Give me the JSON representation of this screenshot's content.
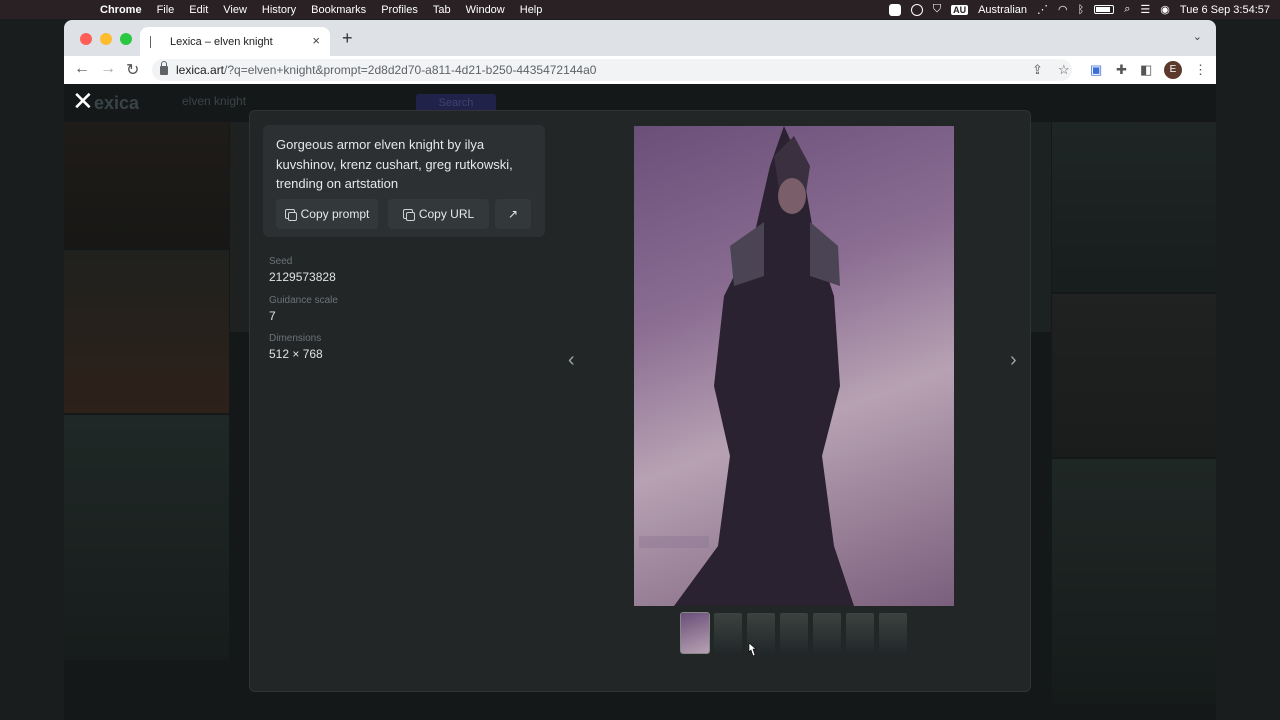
{
  "menubar": {
    "apple": "",
    "app": "Chrome",
    "items": [
      "File",
      "Edit",
      "View",
      "History",
      "Bookmarks",
      "Profiles",
      "Tab",
      "Window",
      "Help"
    ],
    "input_source": "Australian",
    "au": "AU",
    "clock": "Tue 6 Sep  3:54:57"
  },
  "browser": {
    "tab_title": "Lexica – elven knight",
    "url_host": "lexica.art",
    "url_path": "/?q=elven+knight&prompt=2d8d2d70-a811-4d21-b250-4435472144a0",
    "profile_initial": "E"
  },
  "page": {
    "logo_text": "exica",
    "search_query": "elven knight",
    "search_button": "Search",
    "close_label": "✕"
  },
  "modal": {
    "prompt": "Gorgeous armor elven knight by ilya kuvshinov, krenz cushart, greg rutkowski, trending on artstation",
    "copy_prompt_label": "Copy prompt",
    "copy_url_label": "Copy URL",
    "seed_label": "Seed",
    "seed_value": "2129573828",
    "guidance_label": "Guidance scale",
    "guidance_value": "7",
    "dimensions_label": "Dimensions",
    "dimensions_value": "512 × 768",
    "prev_arrow": "‹",
    "next_arrow": "›",
    "thumbnail_count": 7,
    "active_thumbnail": 1
  },
  "colors": {
    "page_bg": "#222627",
    "card_bg": "#2c3032",
    "button_bg": "#33383a",
    "text": "#e6e8e9",
    "muted": "#6c7477"
  }
}
